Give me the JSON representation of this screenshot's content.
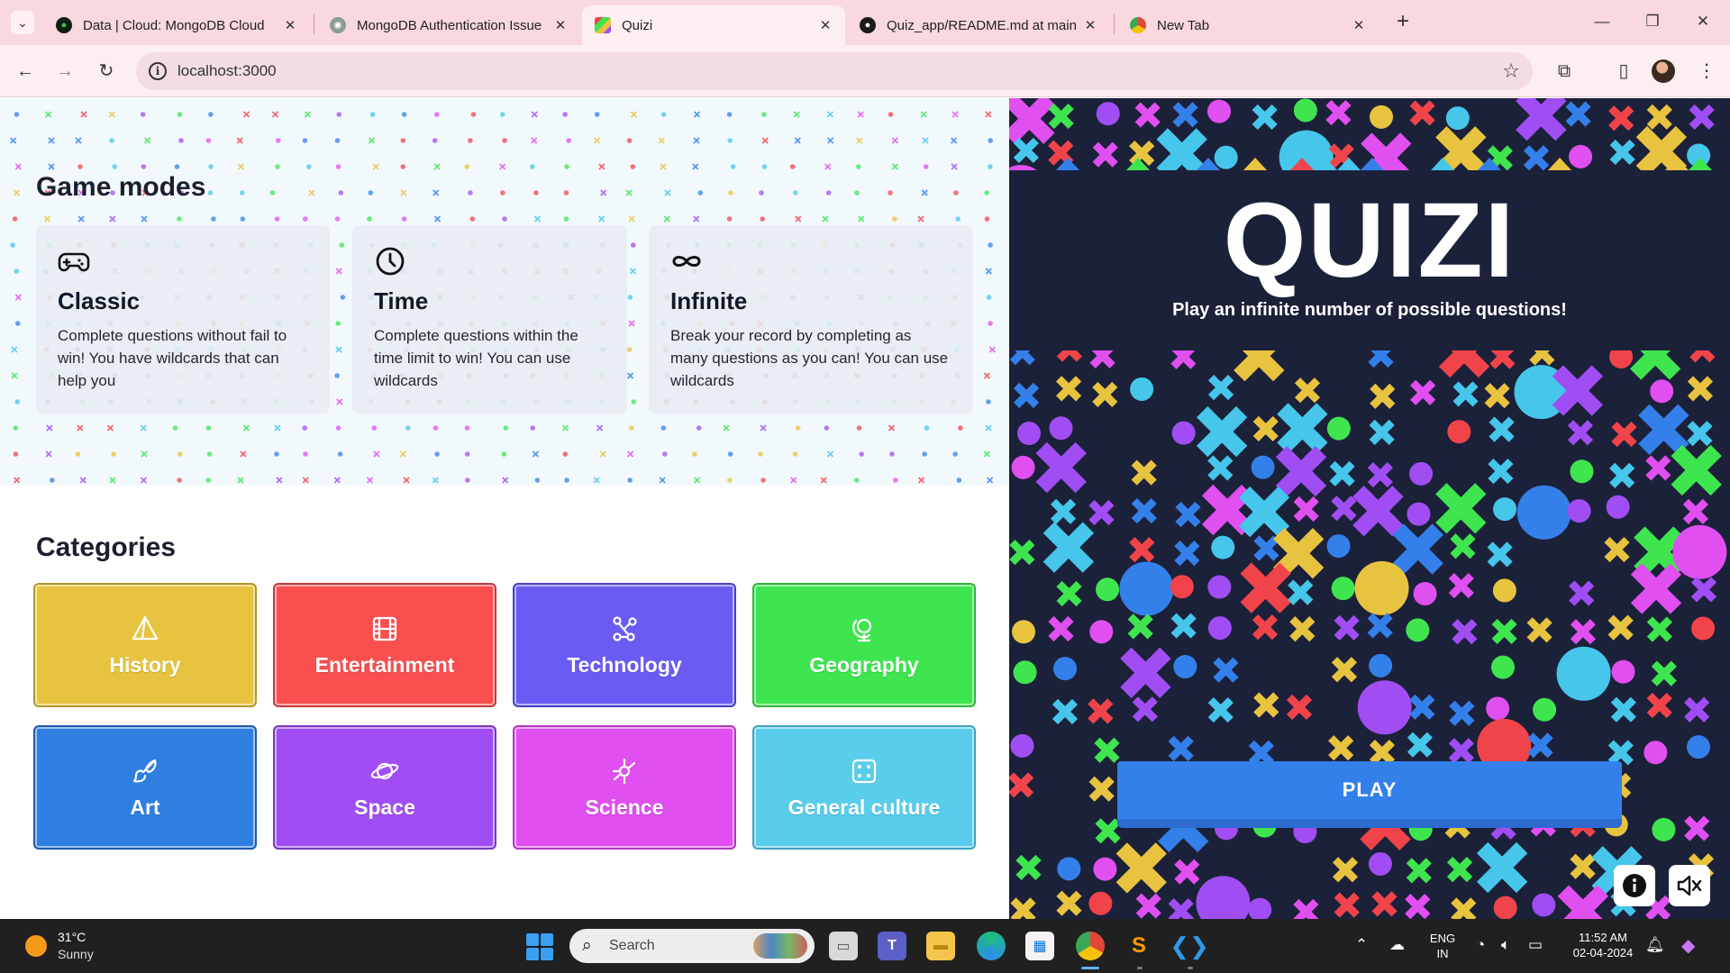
{
  "browser": {
    "tabs": [
      {
        "title": "Data | Cloud: MongoDB Cloud",
        "icon": "mongodb-leaf-icon",
        "active": false
      },
      {
        "title": "MongoDB Authentication Issue",
        "icon": "chatgpt-icon",
        "active": false
      },
      {
        "title": "Quizi",
        "icon": "quizi-icon",
        "active": true
      },
      {
        "title": "Quiz_app/README.md at main",
        "icon": "github-icon",
        "active": false
      },
      {
        "title": "New Tab",
        "icon": "chrome-icon",
        "active": false
      }
    ],
    "close_glyph": "✕",
    "url": "localhost:3000"
  },
  "game_modes": {
    "title": "Game modes",
    "modes": [
      {
        "name": "Classic",
        "icon": "gamepad-icon",
        "description": "Complete questions without fail to win! You have wildcards that can help you"
      },
      {
        "name": "Time",
        "icon": "clock-icon",
        "description": "Complete questions within the time limit to win! You can use wildcards"
      },
      {
        "name": "Infinite",
        "icon": "infinity-icon",
        "description": "Break your record by completing as many questions as you can! You can use wildcards"
      }
    ]
  },
  "categories": {
    "title": "Categories",
    "items": [
      {
        "label": "History",
        "icon": "pyramid-icon",
        "color": "#e8c33f",
        "border": "#b4972b"
      },
      {
        "label": "Entertainment",
        "icon": "film-icon",
        "color": "#f94f4f",
        "border": "#c03c3c"
      },
      {
        "label": "Technology",
        "icon": "nodes-icon",
        "color": "#6a5cf3",
        "border": "#4a3fc0"
      },
      {
        "label": "Geography",
        "icon": "globe-icon",
        "color": "#3ee54f",
        "border": "#2fb53c"
      },
      {
        "label": "Art",
        "icon": "brush-icon",
        "color": "#2f7fe0",
        "border": "#1f5aab"
      },
      {
        "label": "Space",
        "icon": "planet-icon",
        "color": "#a04ef3",
        "border": "#7a38c0"
      },
      {
        "label": "Science",
        "icon": "atom-icon",
        "color": "#e04ff0",
        "border": "#ad3bbd"
      },
      {
        "label": "General culture",
        "icon": "dice-icon",
        "color": "#59cdeb",
        "border": "#3fa2bf"
      }
    ]
  },
  "hero": {
    "logo": "QUIZI",
    "tagline": "Play an infinite number of possible questions!",
    "play_label": "PLAY",
    "info_button_icon": "info-icon",
    "mute_button_icon": "mute-icon"
  },
  "taskbar": {
    "weather_temp": "31°C",
    "weather_desc": "Sunny",
    "search_label": "Search",
    "language": "ENG",
    "region": "IN",
    "time": "11:52 AM",
    "date": "02-04-2024",
    "pinned_apps": [
      "file-explorer-icon",
      "teams-icon",
      "folder-icon",
      "edge-icon",
      "store-icon",
      "chrome-icon",
      "sublime-icon",
      "vscode-icon"
    ]
  },
  "colors": {
    "hero_bg": "#1c213a",
    "play_button": "#3480ea",
    "shape_palette": [
      "#f1444a",
      "#3ee54f",
      "#e8c33f",
      "#3480ea",
      "#a04ef3",
      "#e04ff0",
      "#45c6ea"
    ]
  }
}
